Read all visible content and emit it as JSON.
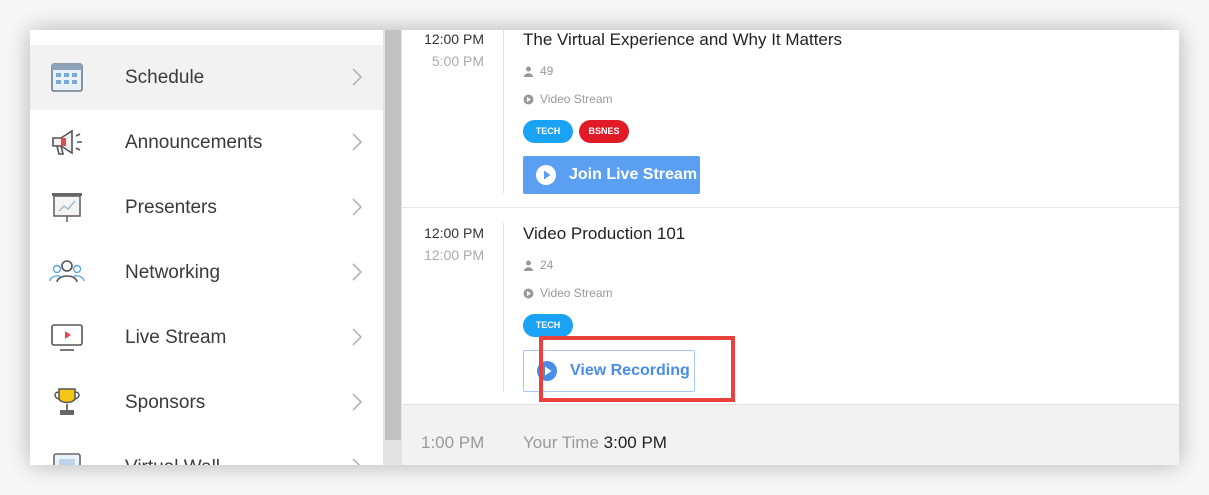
{
  "sidebar": {
    "items": [
      {
        "label": "Schedule",
        "icon": "calendar-icon",
        "active": true
      },
      {
        "label": "Announcements",
        "icon": "megaphone-icon"
      },
      {
        "label": "Presenters",
        "icon": "presentation-board-icon"
      },
      {
        "label": "Networking",
        "icon": "people-icon"
      },
      {
        "label": "Live Stream",
        "icon": "monitor-play-icon"
      },
      {
        "label": "Sponsors",
        "icon": "trophy-icon"
      },
      {
        "label": "Virtual Wall",
        "icon": "photo-wall-icon"
      }
    ]
  },
  "sessions": [
    {
      "start": "12:00 PM",
      "end": "5:00 PM",
      "title": "The Virtual Experience and Why It Matters",
      "attendees": "49",
      "stream_type": "Video Stream",
      "tags": [
        {
          "label": "TECH",
          "color": "#1aa3f5"
        },
        {
          "label": "BSNES",
          "color": "#e01b26"
        }
      ],
      "button": "Join Live Stream"
    },
    {
      "start": "12:00 PM",
      "end": "12:00 PM",
      "title": "Video Production 101",
      "attendees": "24",
      "stream_type": "Video Stream",
      "tags": [
        {
          "label": "TECH",
          "color": "#1aa3f5"
        }
      ],
      "button": "View Recording"
    }
  ],
  "footer": {
    "time": "1:00 PM",
    "your_time_label": "Your Time",
    "your_time_value": "3:00 PM"
  },
  "colors": {
    "primary_button": "#5b9ff2",
    "highlight": "#e8413e",
    "tech_tag": "#1aa3f5",
    "bsnes_tag": "#e01b26"
  }
}
